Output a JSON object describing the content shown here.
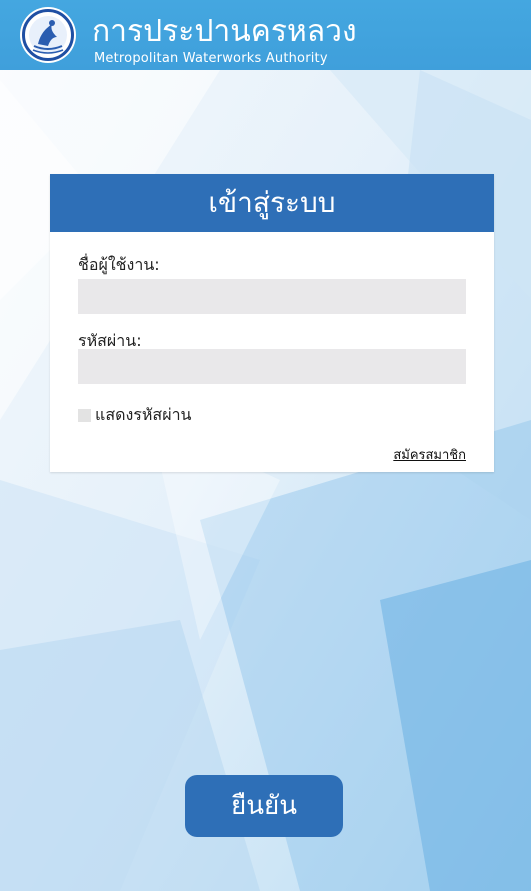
{
  "header": {
    "org_name_th": "การประปานครหลวง",
    "org_name_en": "Metropolitan Waterworks Authority",
    "logo_icon": "mwa-seal-logo-icon",
    "background_color": "#44a7e0"
  },
  "login": {
    "title": "เข้าสู่ระบบ",
    "title_bar_color": "#2e6fb7",
    "username_label": "ชื่อผู้ใช้งาน:",
    "username_value": "",
    "password_label": "รหัสผ่าน:",
    "password_value": "",
    "show_password_label": "แสดงรหัสผ่าน",
    "show_password_checked": false,
    "register_link": "สมัครสมาชิก"
  },
  "actions": {
    "confirm_label": "ยืนยัน",
    "confirm_color": "#2e6fb7"
  }
}
